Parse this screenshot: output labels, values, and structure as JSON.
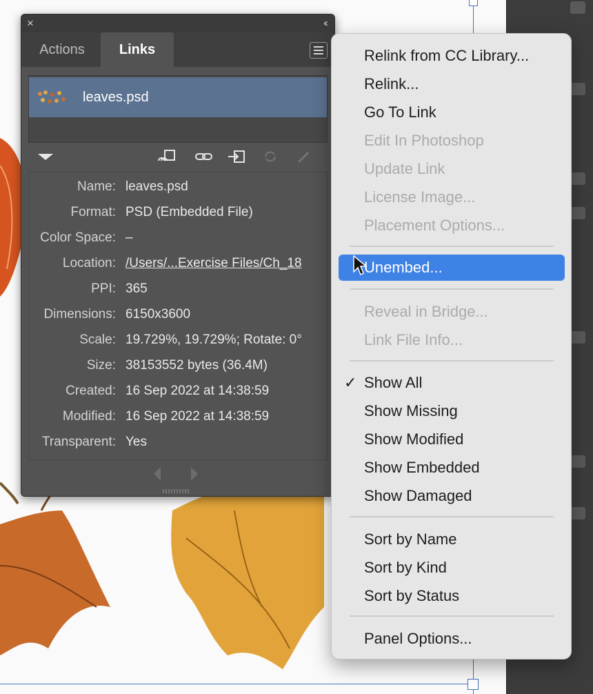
{
  "canvas": {
    "artboard_color": "#4a6fb8"
  },
  "panel": {
    "close_icon": "close-icon",
    "collapse_icon": "double-chevron-left-icon",
    "tabs": [
      {
        "label": "Actions",
        "active": false
      },
      {
        "label": "Links",
        "active": true
      }
    ],
    "menu_icon": "hamburger-menu-icon",
    "selected_color": "#5b7290",
    "links": [
      {
        "name": "leaves.psd",
        "thumb_icon": "leaves-thumbnail"
      }
    ],
    "toolbar_icons": [
      "relink-from-cc-library-icon",
      "relink-icon",
      "go-to-link-icon",
      "update-link-icon",
      "edit-original-icon"
    ],
    "info": {
      "name": {
        "label": "Name:",
        "value": "leaves.psd"
      },
      "format": {
        "label": "Format:",
        "value": "PSD (Embedded File)"
      },
      "color_space": {
        "label": "Color Space:",
        "value": "–"
      },
      "location": {
        "label": "Location:",
        "value": "/Users/...Exercise Files/Ch_18"
      },
      "ppi": {
        "label": "PPI:",
        "value": "365"
      },
      "dimensions": {
        "label": "Dimensions:",
        "value": "6150x3600"
      },
      "scale": {
        "label": "Scale:",
        "value": "19.729%, 19.729%; Rotate: 0°"
      },
      "size": {
        "label": "Size:",
        "value": "38153552 bytes (36.4M)"
      },
      "created": {
        "label": "Created:",
        "value": "16 Sep 2022 at 14:38:59"
      },
      "modified": {
        "label": "Modified:",
        "value": "16 Sep 2022 at 14:38:59"
      },
      "transparent": {
        "label": "Transparent:",
        "value": "Yes"
      }
    }
  },
  "menu": {
    "highlight_color": "#3f82e6",
    "items": [
      {
        "label": "Relink from CC Library...",
        "enabled": true
      },
      {
        "label": "Relink...",
        "enabled": true
      },
      {
        "label": "Go To Link",
        "enabled": true
      },
      {
        "label": "Edit In Photoshop",
        "enabled": false
      },
      {
        "label": "Update Link",
        "enabled": false
      },
      {
        "label": "License Image...",
        "enabled": false
      },
      {
        "label": "Placement Options...",
        "enabled": false
      },
      {
        "label": "Unembed...",
        "enabled": true,
        "selected": true
      },
      {
        "label": "Reveal in Bridge...",
        "enabled": false
      },
      {
        "label": "Link File Info...",
        "enabled": false
      },
      {
        "label": "Show All",
        "enabled": true,
        "checked": true,
        "check_mark": "✓"
      },
      {
        "label": "Show Missing",
        "enabled": true
      },
      {
        "label": "Show Modified",
        "enabled": true
      },
      {
        "label": "Show Embedded",
        "enabled": true
      },
      {
        "label": "Show Damaged",
        "enabled": true
      },
      {
        "label": "Sort by Name",
        "enabled": true
      },
      {
        "label": "Sort by Kind",
        "enabled": true
      },
      {
        "label": "Sort by Status",
        "enabled": true
      },
      {
        "label": "Panel Options...",
        "enabled": true
      }
    ]
  }
}
